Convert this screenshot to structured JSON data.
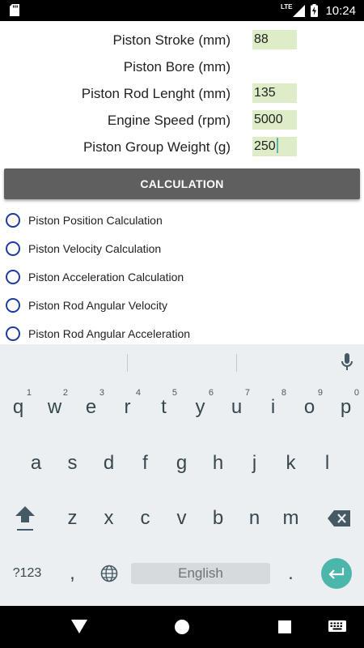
{
  "status_bar": {
    "network": "LTE",
    "time": "10:24"
  },
  "form": {
    "fields": [
      {
        "label": "Piston Stroke (mm)",
        "value": "88"
      },
      {
        "label": "Piston Bore (mm)",
        "value": ""
      },
      {
        "label": "Piston Rod Lenght (mm)",
        "value": "135"
      },
      {
        "label": "Engine Speed (rpm)",
        "value": "5000"
      },
      {
        "label": "Piston Group Weight (g)",
        "value": "250"
      }
    ],
    "calc_button": "CALCULATION",
    "options": [
      {
        "label": "Piston Position Calculation"
      },
      {
        "label": "Piston Velocity Calculation"
      },
      {
        "label": "Piston Acceleration Calculation"
      },
      {
        "label": "Piston Rod Angular Velocity"
      },
      {
        "label": "Piston Rod Angular Acceleration"
      }
    ]
  },
  "keyboard": {
    "row1": [
      "q",
      "w",
      "e",
      "r",
      "t",
      "y",
      "u",
      "i",
      "o",
      "p"
    ],
    "row1_hints": [
      "1",
      "2",
      "3",
      "4",
      "5",
      "6",
      "7",
      "8",
      "9",
      "0"
    ],
    "row2": [
      "a",
      "s",
      "d",
      "f",
      "g",
      "h",
      "j",
      "k",
      "l"
    ],
    "row3": [
      "z",
      "x",
      "c",
      "v",
      "b",
      "n",
      "m"
    ],
    "symbols_key": "?123",
    "comma_key": ",",
    "period_key": ".",
    "space_label": "English"
  },
  "colors": {
    "field_bg": "#dcedc8",
    "button_bg": "#5f5f5f",
    "radio": "#1c3aa9",
    "enter_bg": "#4db6ac",
    "keyboard_bg": "#eceff1"
  }
}
